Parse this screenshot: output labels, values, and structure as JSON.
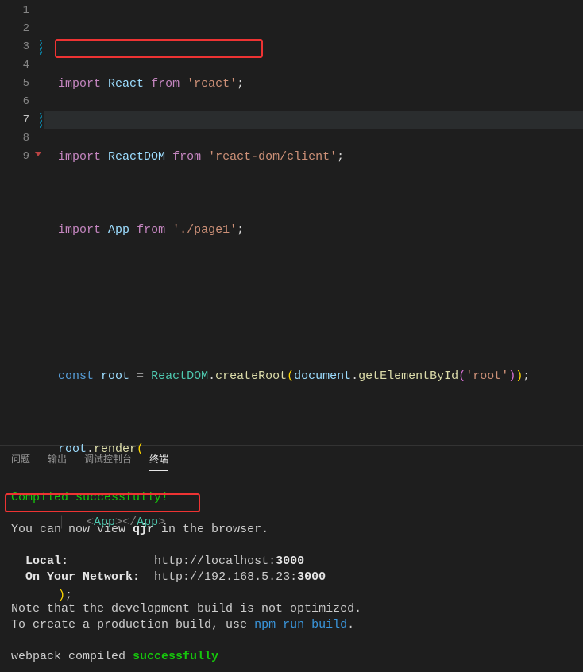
{
  "editor": {
    "line_numbers": [
      "1",
      "2",
      "3",
      "4",
      "5",
      "6",
      "7",
      "8",
      "9"
    ],
    "code": {
      "l1": {
        "kw1": "import",
        "id": "React",
        "kw2": "from",
        "str": "'react'",
        "semi": ";"
      },
      "l2": {
        "kw1": "import",
        "id": "ReactDOM",
        "kw2": "from",
        "str": "'react-dom/client'",
        "semi": ";"
      },
      "l3": {
        "kw1": "import",
        "id": "App",
        "kw2": "from",
        "str": "'./page1'",
        "semi": ";"
      },
      "l5": {
        "kw": "const",
        "id": "root",
        "eq": " = ",
        "cls": "ReactDOM",
        "dot1": ".",
        "fn1": "createRoot",
        "lp": "(",
        "obj": "document",
        "dot2": ".",
        "fn2": "getElementById",
        "lp2": "(",
        "str": "'root'",
        "rp2": ")",
        "rp": ")",
        "semi": ";"
      },
      "l6": {
        "id": "root",
        "dot": ".",
        "fn": "render",
        "lp": "("
      },
      "l7": {
        "open": "<",
        "tag1": "App",
        "close1": ">",
        "open2": "</",
        "tag2": "App",
        "close2": ">"
      },
      "l8": {
        "rp": ")",
        "semi": ";"
      }
    }
  },
  "panel": {
    "tabs": {
      "problems": "问题",
      "output": "输出",
      "debug": "调试控制台",
      "terminal": "终端"
    },
    "term": {
      "l1": "Compiled successfully!",
      "l2a": "You can now view ",
      "l2b": "qjr",
      "l2c": " in the browser.",
      "l3a": "  ",
      "l3b": "Local:",
      "l3c": "            http://localhost:",
      "l3d": "3000",
      "l4a": "  ",
      "l4b": "On Your Network:",
      "l4c": "  http://192.168.5.23:",
      "l4d": "3000",
      "l5": "Note that the development build is not optimized.",
      "l6a": "To create a production build, use ",
      "l6b": "npm run build",
      "l6c": ".",
      "l7a": "webpack compiled ",
      "l7b": "successfully"
    }
  }
}
